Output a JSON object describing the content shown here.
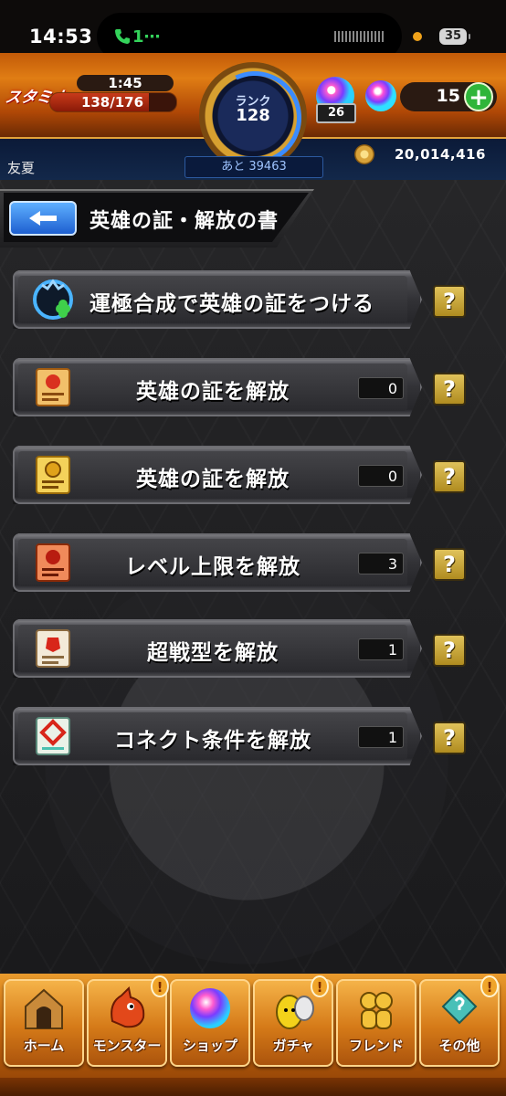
{
  "status_bar": {
    "time": "14:53",
    "call_indicator": "1⋯",
    "battery": "35"
  },
  "header": {
    "stamina_label": "スタミナ",
    "stamina_timer": "1:45",
    "stamina_value": "138/176",
    "stamina_fraction": 0.784,
    "rank_label": "ランク",
    "rank_value": "128",
    "next_exp": "あと 39463",
    "orb_stack_count": "26",
    "orb_value": "15",
    "plus_label": "+",
    "username": "友夏",
    "gold_value": "20,014,416"
  },
  "page": {
    "title": "英雄の証・解放の書"
  },
  "menu_items": [
    {
      "label": "運極合成で英雄の証をつける",
      "count": null,
      "icon": "luck-clover-icon"
    },
    {
      "label": "英雄の証を解放",
      "count": "0",
      "icon": "red-scroll-icon"
    },
    {
      "label": "英雄の証を解放",
      "count": "0",
      "icon": "gold-scroll-icon"
    },
    {
      "label": "レベル上限を解放",
      "count": "3",
      "icon": "level-scroll-icon"
    },
    {
      "label": "超戦型を解放",
      "count": "1",
      "icon": "battle-type-scroll-icon"
    },
    {
      "label": "コネクト条件を解放",
      "count": "1",
      "icon": "connect-scroll-icon"
    }
  ],
  "help_label": "?",
  "nav": [
    {
      "label": "ホーム",
      "icon": "home-icon"
    },
    {
      "label": "モンスター",
      "icon": "monster-icon",
      "badge": "!"
    },
    {
      "label": "ショップ",
      "icon": "shop-orb-icon"
    },
    {
      "label": "ガチャ",
      "icon": "gacha-egg-icon",
      "badge": "!"
    },
    {
      "label": "フレンド",
      "icon": "friend-icon"
    },
    {
      "label": "その他",
      "icon": "other-icon",
      "badge": "!"
    }
  ],
  "colors": {
    "header_orange": "#e07d14",
    "row_dark": "#2a2a2e",
    "help_gold": "#c9a434",
    "nav_orange": "#d57a18"
  }
}
